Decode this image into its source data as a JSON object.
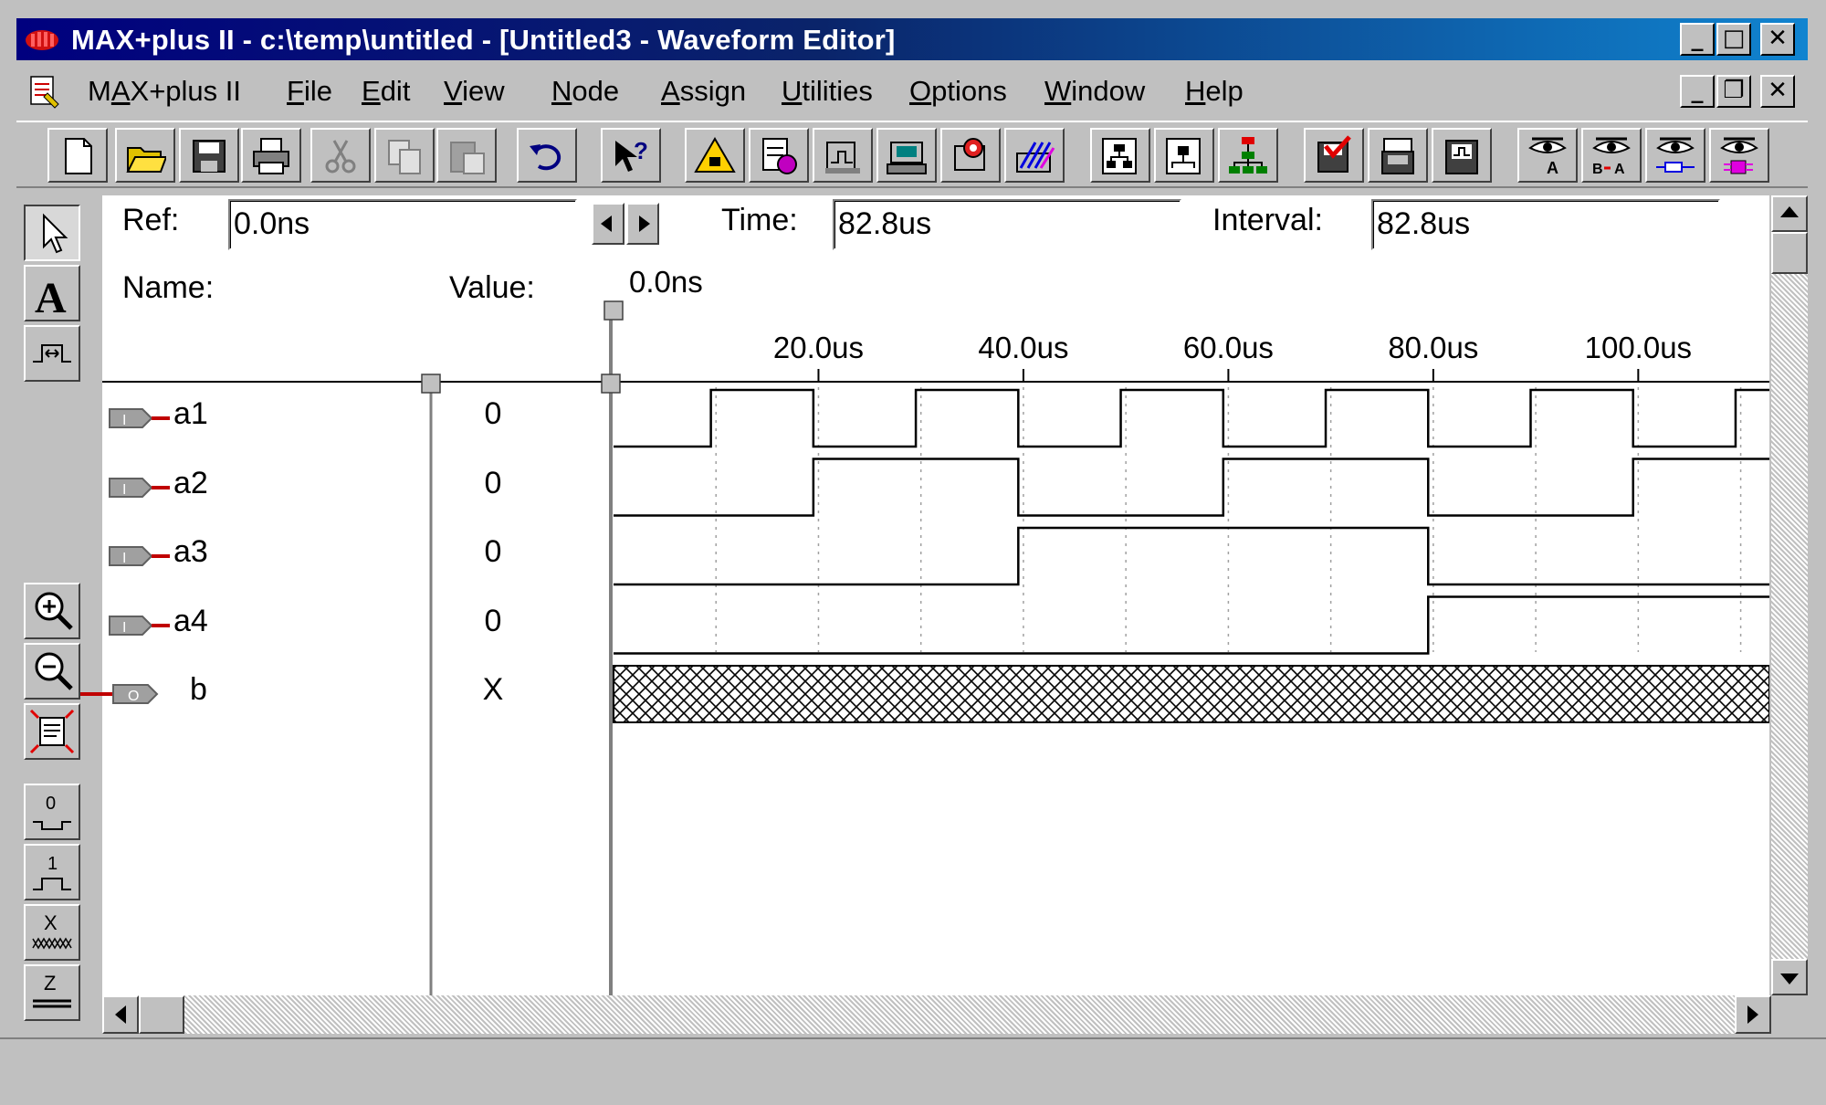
{
  "window": {
    "title": "MAX+plus II - c:\\temp\\untitled - [Untitled3 - Waveform Editor]",
    "min_glyph": "_",
    "max_glyph": "□",
    "close_glyph": "✕",
    "restore_glyph": "❐"
  },
  "menu": {
    "items": [
      {
        "label": "MAX+plus II",
        "mnemonic": "A"
      },
      {
        "label": "File",
        "mnemonic": "F"
      },
      {
        "label": "Edit",
        "mnemonic": "E"
      },
      {
        "label": "View",
        "mnemonic": "V"
      },
      {
        "label": "Node",
        "mnemonic": "N"
      },
      {
        "label": "Assign",
        "mnemonic": "A"
      },
      {
        "label": "Utilities",
        "mnemonic": "U"
      },
      {
        "label": "Options",
        "mnemonic": "O"
      },
      {
        "label": "Window",
        "mnemonic": "W"
      },
      {
        "label": "Help",
        "mnemonic": "H"
      }
    ]
  },
  "toolbar": {
    "icons": [
      "new-file-icon",
      "open-folder-icon",
      "save-icon",
      "print-icon",
      "cut-icon",
      "copy-icon",
      "paste-icon",
      "undo-icon",
      "context-help-icon",
      "compiler-icon",
      "simulator-icon",
      "timing-analyzer-icon",
      "programmer-icon",
      "message-processor-icon",
      "floorplan-icon",
      "hierarchy-icon",
      "top-level-icon",
      "design-tree-icon",
      "save-check-icon",
      "save-compile-icon",
      "save-simulate-icon",
      "find-node-icon",
      "find-node-ba-icon",
      "find-node-pin-icon",
      "find-node-buried-icon"
    ]
  },
  "palette": {
    "icons": [
      "selection-tool-icon",
      "text-tool-icon",
      "waveform-edit-icon",
      "zoom-in-icon",
      "zoom-out-icon",
      "fit-window-icon",
      "set-zero-icon",
      "set-one-icon",
      "set-x-icon",
      "set-z-icon"
    ],
    "labels": {
      "zero": "0",
      "one": "1",
      "x": "X",
      "z": "Z",
      "text": "A"
    }
  },
  "editor": {
    "ref_label": "Ref:",
    "ref_value": "0.0ns",
    "time_label": "Time:",
    "time_value": "82.8us",
    "interval_label": "Interval:",
    "interval_value": "82.8us",
    "cursor_label": "0.0ns",
    "name_header": "Name:",
    "value_header": "Value:",
    "time_ticks": [
      {
        "t": 20,
        "label": "20.0us"
      },
      {
        "t": 40,
        "label": "40.0us"
      },
      {
        "t": 60,
        "label": "60.0us"
      },
      {
        "t": 80,
        "label": "80.0us"
      },
      {
        "t": 100,
        "label": "100.0us"
      }
    ],
    "time_range_us": [
      0,
      112.8
    ],
    "nodes": [
      {
        "name": "a1",
        "type": "input",
        "value": "0",
        "transitions_us": [
          9.5,
          19.5,
          29.5,
          39.5,
          49.5,
          59.5,
          69.5,
          79.5,
          89.5,
          99.5,
          109.5
        ]
      },
      {
        "name": "a2",
        "type": "input",
        "value": "0",
        "transitions_us": [
          19.5,
          39.5,
          59.5,
          79.5,
          99.5
        ]
      },
      {
        "name": "a3",
        "type": "input",
        "value": "0",
        "transitions_us": [
          39.5,
          79.5
        ]
      },
      {
        "name": "a4",
        "type": "input",
        "value": "0",
        "transitions_us": [
          79.5
        ]
      },
      {
        "name": "b",
        "type": "output",
        "value": "X",
        "transitions_us": []
      }
    ],
    "node_type_labels": {
      "input": "I",
      "output": "O"
    }
  }
}
